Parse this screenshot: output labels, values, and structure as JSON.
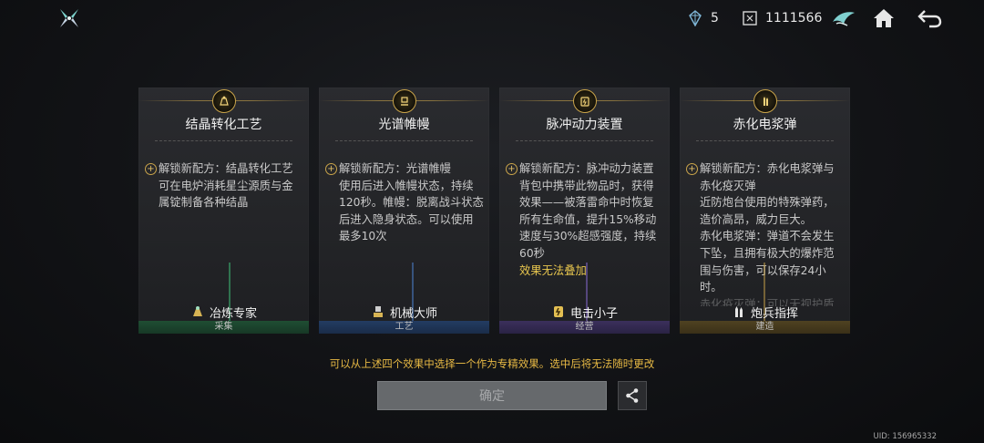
{
  "topbar": {
    "logo_icon": "star-compass-icon",
    "resource_a": {
      "icon": "crystal-icon",
      "value": "5"
    },
    "resource_b": {
      "icon": "credits-icon",
      "value": "1111566"
    },
    "buttons": [
      "ship-icon",
      "home-icon",
      "back-arrow-icon"
    ]
  },
  "cards": [
    {
      "title": "结晶转化工艺",
      "badge_icon": "smelter-icon",
      "lines": [
        "解锁新配方：结晶转化工艺",
        "可在电炉消耗星尘源质与金",
        "属锭制备各种结晶"
      ],
      "note": "",
      "footer_label": "冶炼专家",
      "footer_icon": "smelter-icon",
      "category": "采集",
      "accent": "#2f9c55"
    },
    {
      "title": "光谱帷幔",
      "badge_icon": "robot-icon",
      "lines": [
        "解锁新配方：光谱帷幔",
        "使用后进入帷幔状态，持续",
        "120秒。帷幔：脱离战斗状态",
        "后进入隐身状态。可以使用",
        "最多10次"
      ],
      "note": "",
      "footer_label": "机械大师",
      "footer_icon": "robot-icon",
      "category": "工艺",
      "accent": "#2f5fa8"
    },
    {
      "title": "脉冲动力装置",
      "badge_icon": "battery-icon",
      "lines": [
        "解锁新配方：脉冲动力装置",
        "背包中携带此物品时，获得",
        "效果——被落雷命中时恢复",
        "所有生命值，提升15%移动",
        "速度与30%超感强度，持续",
        "60秒"
      ],
      "note": "效果无法叠加",
      "footer_label": "电击小子",
      "footer_icon": "battery-icon",
      "category": "经营",
      "accent": "#6a4fa6"
    },
    {
      "title": "赤化电浆弹",
      "badge_icon": "shells-icon",
      "lines": [
        "解锁新配方：赤化电浆弹与",
        "赤化疫灭弹",
        "近防炮台使用的特殊弹药，",
        "造价高昂，威力巨大。",
        "赤化电浆弹：弹道不会发生",
        "下坠，且拥有极大的爆炸范",
        "围与伤害，可以保存24小",
        "时。",
        "赤化疫灭弹：可以无视护盾"
      ],
      "note": "",
      "footer_label": "炮兵指挥",
      "footer_icon": "shells-icon",
      "category": "建造",
      "accent": "#9c7a2b"
    }
  ],
  "hint": "可以从上述四个效果中选择一个作为专精效果。选中后将无法随时更改",
  "confirm_label": "确定",
  "share_icon": "share-icon",
  "uid": "UID: 156965332"
}
